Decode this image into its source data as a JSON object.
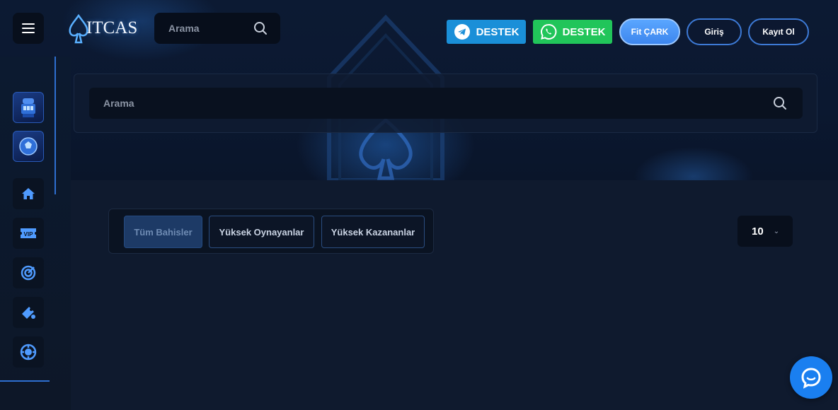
{
  "header": {
    "logo_text": "ITCAS",
    "search_placeholder": "Arama",
    "telegram_label": "DESTEK",
    "whatsapp_label": "DESTEK",
    "wheel_label": "Fit ÇARK",
    "login_label": "Giriş",
    "register_label": "Kayıt Ol"
  },
  "sidebar": {
    "items": [
      {
        "icon": "casino-thumbnail"
      },
      {
        "icon": "sports-thumbnail"
      },
      {
        "icon": "home-icon"
      },
      {
        "icon": "vip-icon"
      },
      {
        "icon": "target-icon"
      },
      {
        "icon": "promotion-icon"
      },
      {
        "icon": "chip-icon"
      }
    ]
  },
  "main": {
    "search_placeholder": "Arama",
    "tabs": [
      {
        "label": "Tüm Bahisler",
        "active": true
      },
      {
        "label": "Yüksek Oynayanlar",
        "active": false
      },
      {
        "label": "Yüksek Kazananlar",
        "active": false
      }
    ],
    "page_size": "10"
  },
  "colors": {
    "accent": "#3d86ee",
    "telegram": "#1a8fd8",
    "whatsapp": "#21c55a",
    "chat": "#1a7ff0"
  }
}
